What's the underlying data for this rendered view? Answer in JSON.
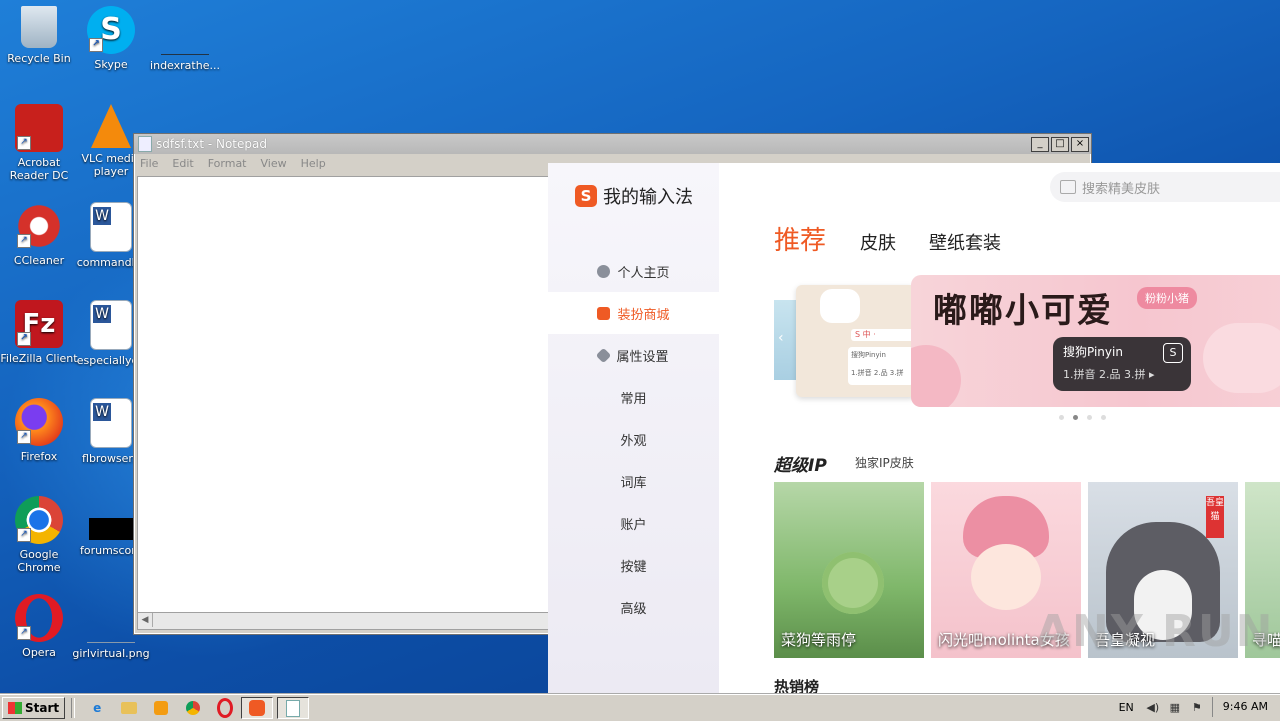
{
  "desktop": {
    "icons": [
      {
        "label": "Recycle Bin"
      },
      {
        "label": "Skype"
      },
      {
        "label": "indexrathe..."
      },
      {
        "label": "Acrobat Reader DC"
      },
      {
        "label": "VLC media player"
      },
      {
        "label": "CCleaner"
      },
      {
        "label": "commandbo"
      },
      {
        "label": "FileZilla Client"
      },
      {
        "label": "especiallyde"
      },
      {
        "label": "Firefox"
      },
      {
        "label": "flbrowser.r"
      },
      {
        "label": "Google Chrome"
      },
      {
        "label": "forumscom"
      },
      {
        "label": "Opera"
      },
      {
        "label": "girlvirtual.png"
      }
    ]
  },
  "notepad": {
    "title": "sdfsf.txt - Notepad",
    "menu": [
      "File",
      "Edit",
      "Format",
      "View",
      "Help"
    ],
    "controls": {
      "minimize": "_",
      "maximize": "□",
      "close": "×"
    }
  },
  "sogou": {
    "logo_text": "我的输入法",
    "logo_letter": "S",
    "nav": [
      {
        "label": "个人主页"
      },
      {
        "label": "装扮商城"
      },
      {
        "label": "属性设置"
      },
      {
        "label": "常用"
      },
      {
        "label": "外观"
      },
      {
        "label": "词库"
      },
      {
        "label": "账户"
      },
      {
        "label": "按键"
      },
      {
        "label": "高级"
      }
    ],
    "search_placeholder": "搜索精美皮肤",
    "tabs": [
      {
        "label": "推荐",
        "active": true
      },
      {
        "label": "皮肤"
      },
      {
        "label": "壁纸套装"
      }
    ],
    "banner": {
      "title": "嘟嘟小可爱",
      "badge": "粉粉小猪",
      "kb_line1": "搜狗Pinyin",
      "kb_line2": "1.拼音  2.品  3.拼 ▸",
      "kb_icon": "S",
      "mini_bar": "S 中 ·",
      "mini_card_1": "搜狗Pinyin",
      "mini_card_2": "1.拼音  2.品  3.拼",
      "prev_arrow": "‹"
    },
    "carousel_dots": 4,
    "carousel_active": 1,
    "section": {
      "title": "超级IP",
      "subtitle": "独家IP皮肤"
    },
    "cards": [
      {
        "caption": "菜狗等雨停"
      },
      {
        "caption": "闪光吧molinta女孩"
      },
      {
        "caption": "吾皇凝视",
        "tag": "吾皇猫"
      },
      {
        "caption": "寻喵"
      }
    ],
    "hot_title": "热销榜"
  },
  "watermark": "ANY RUN",
  "taskbar": {
    "start_label": "Start",
    "lang": "EN",
    "time": "9:46 AM"
  },
  "colors": {
    "accent": "#ef5a24",
    "desktop": "#1565c0"
  }
}
